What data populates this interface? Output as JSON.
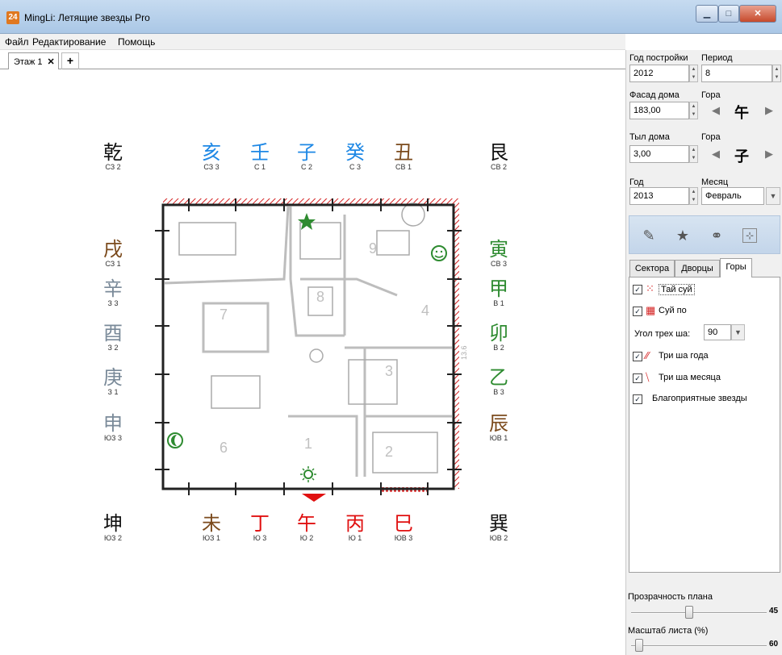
{
  "window": {
    "title": "MingLi: Летящие звезды Pro",
    "icon": "24"
  },
  "menu": [
    "Файл",
    "Редактирование",
    "Помощь"
  ],
  "tabs": {
    "floor": "Этаж 1",
    "close": "✕",
    "add": "+"
  },
  "compass": {
    "top": [
      {
        "ch": "乾",
        "lab": "СЗ 2",
        "color": "#111111"
      },
      {
        "ch": "亥",
        "lab": "СЗ 3",
        "color": "#1e88e5"
      },
      {
        "ch": "壬",
        "lab": "С 1",
        "color": "#1e88e5"
      },
      {
        "ch": "子",
        "lab": "С 2",
        "color": "#1e88e5"
      },
      {
        "ch": "癸",
        "lab": "С 3",
        "color": "#1e88e5"
      },
      {
        "ch": "丑",
        "lab": "СВ 1",
        "color": "#7b4a1c"
      },
      {
        "ch": "艮",
        "lab": "СВ 2",
        "color": "#111111"
      }
    ],
    "left": [
      {
        "ch": "戌",
        "lab": "СЗ 1",
        "color": "#7b4a1c"
      },
      {
        "ch": "辛",
        "lab": "З 3",
        "color": "#7a8a99"
      },
      {
        "ch": "酉",
        "lab": "З 2",
        "color": "#7a8a99"
      },
      {
        "ch": "庚",
        "lab": "З 1",
        "color": "#7a8a99"
      },
      {
        "ch": "申",
        "lab": "ЮЗ 3",
        "color": "#7a8a99"
      }
    ],
    "right": [
      {
        "ch": "寅",
        "lab": "СВ 3",
        "color": "#2e8b30"
      },
      {
        "ch": "甲",
        "lab": "В 1",
        "color": "#2e8b30"
      },
      {
        "ch": "卯",
        "lab": "В 2",
        "color": "#2e8b30"
      },
      {
        "ch": "乙",
        "lab": "В 3",
        "color": "#2e8b30"
      },
      {
        "ch": "辰",
        "lab": "ЮВ 1",
        "color": "#7b4a1c"
      }
    ],
    "bottom": [
      {
        "ch": "坤",
        "lab": "ЮЗ 2",
        "color": "#111111"
      },
      {
        "ch": "未",
        "lab": "ЮЗ 1",
        "color": "#7b4a1c"
      },
      {
        "ch": "丁",
        "lab": "Ю 3",
        "color": "#e01010"
      },
      {
        "ch": "午",
        "lab": "Ю 2",
        "color": "#e01010"
      },
      {
        "ch": "丙",
        "lab": "Ю 1",
        "color": "#e01010"
      },
      {
        "ch": "巳",
        "lab": "ЮВ 3",
        "color": "#e01010"
      },
      {
        "ch": "巽",
        "lab": "ЮВ 2",
        "color": "#111111"
      }
    ]
  },
  "plan": {
    "rooms": [
      "1",
      "2",
      "3",
      "4",
      "6",
      "7",
      "8",
      "9"
    ],
    "dimension": "13.6",
    "star_color": "#2e8b30"
  },
  "panel": {
    "year_built_label": "Год постройки",
    "year_built": "2012",
    "period_label": "Период",
    "period": "8",
    "facade_label": "Фасад дома",
    "facade": "183,00",
    "mountain_label": "Гора",
    "facade_mountain": "午",
    "back_label": "Тыл дома",
    "back": "3,00",
    "back_mountain": "子",
    "year_label": "Год",
    "year": "2013",
    "month_label": "Месяц",
    "month": "Февраль"
  },
  "rtabs": [
    "Сектора",
    "Дворцы",
    "Горы"
  ],
  "options": {
    "tai_sui": "Тай суй",
    "sui_po": "Суй по",
    "three_sha_angle_label": "Угол трех ша:",
    "three_sha_angle": "90",
    "three_sha_year": "Три ша года",
    "three_sha_month": "Три ша месяца",
    "good_stars": "Благоприятные звезды"
  },
  "sliders": {
    "plan_opacity_label": "Прозрачность плана",
    "plan_opacity": 45,
    "sheet_scale_label": "Масштаб листа (%)",
    "sheet_scale": 60
  }
}
